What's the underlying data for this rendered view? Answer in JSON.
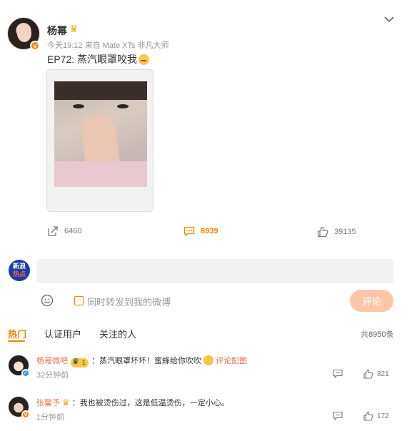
{
  "post": {
    "author": "杨幂",
    "meta": "今天19:12  来自 Mate XTs 非凡大师",
    "text": "EP72: 蒸汽眼罩咬我",
    "reposts": "6460",
    "comments": "8939",
    "likes": "39135"
  },
  "composer": {
    "avatar_line1": "新浪",
    "avatar_line2": "热点",
    "input_value": "",
    "repost_label": "同时转发到我的微博",
    "submit_label": "评论"
  },
  "tabs": [
    {
      "label": "热门",
      "active": true
    },
    {
      "label": "认证用户",
      "active": false
    },
    {
      "label": "关注的人",
      "active": false
    }
  ],
  "total": "共8950条",
  "comments": [
    {
      "name": "杨幂微吧",
      "badge_level": "1",
      "text": "：蒸汽眼罩坏坏！蜜蜂给你吹吹",
      "link": "评论配图",
      "time": "32分钟前",
      "likes": "821"
    },
    {
      "name": "张馨予",
      "text": "：我也被烫伤过，这是低温烫伤，一定小心。",
      "time": "1分钟前",
      "likes": "172"
    }
  ],
  "colors": {
    "accent": "#ff8200",
    "username": "#eb7350",
    "submit_disabled": "#fbc7a8"
  },
  "icons": [
    "chevron-down-icon",
    "share-icon",
    "comment-icon",
    "like-icon",
    "smile-icon",
    "crown-icon",
    "verified-badge-icon",
    "reply-icon"
  ]
}
